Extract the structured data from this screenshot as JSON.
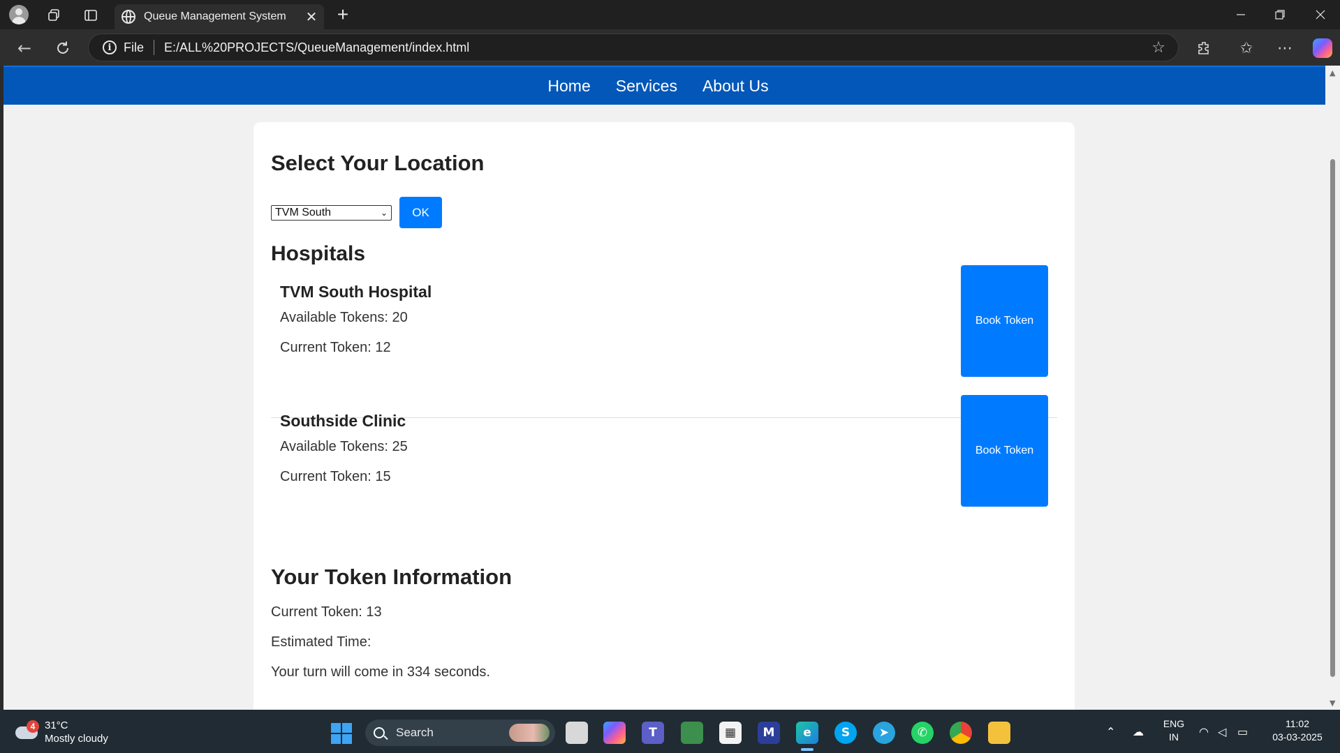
{
  "browser": {
    "tab_title": "Queue Management System",
    "file_label": "File",
    "url": "E:/ALL%20PROJECTS/QueueManagement/index.html"
  },
  "nav": {
    "items": [
      {
        "label": "Home"
      },
      {
        "label": "Services"
      },
      {
        "label": "About Us"
      }
    ]
  },
  "location": {
    "heading": "Select Your Location",
    "selected": "TVM South",
    "ok_label": "OK"
  },
  "hospitals": {
    "heading": "Hospitals",
    "items": [
      {
        "name": "TVM South Hospital",
        "available": "Available Tokens: 20",
        "current": "Current Token: 12",
        "button": "Book Token"
      },
      {
        "name": "Southside Clinic",
        "available": "Available Tokens: 25",
        "current": "Current Token: 15",
        "button": "Book Token"
      }
    ]
  },
  "token_info": {
    "heading": "Your Token Information",
    "current": "Current Token: 13",
    "estimated": "Estimated Time:",
    "turn": "Your turn will come in 334 seconds."
  },
  "taskbar": {
    "weather_badge": "4",
    "temperature": "31°C",
    "condition": "Mostly cloudy",
    "search_label": "Search",
    "lang_top": "ENG",
    "lang_bottom": "IN",
    "time": "11:02",
    "date": "03-03-2025"
  },
  "colors": {
    "navbar": "#0357b8",
    "button": "#007bff",
    "page_bg": "#f1f1f1"
  }
}
